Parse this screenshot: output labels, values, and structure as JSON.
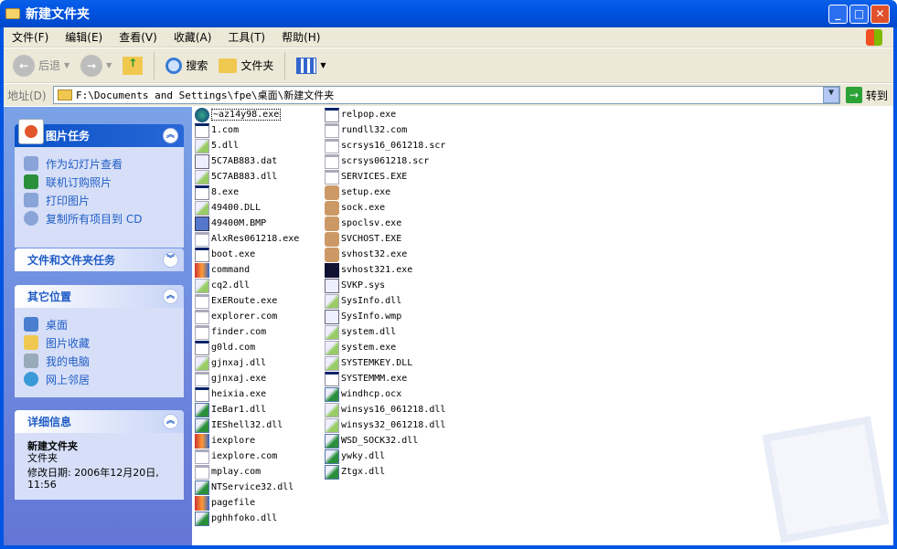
{
  "window": {
    "title": "新建文件夹",
    "min": "_",
    "max": "□",
    "close": "✕"
  },
  "menu": [
    "文件(F)",
    "编辑(E)",
    "查看(V)",
    "收藏(A)",
    "工具(T)",
    "帮助(H)"
  ],
  "toolbar": {
    "back": "后退",
    "search": "搜索",
    "folders": "文件夹"
  },
  "address": {
    "label": "地址(D)",
    "value": "F:\\Documents and Settings\\fpe\\桌面\\新建文件夹",
    "go": "转到"
  },
  "panels": {
    "picture_tasks": {
      "title": "图片任务",
      "links": [
        "作为幻灯片查看",
        "联机订购照片",
        "打印图片",
        "复制所有项目到 CD"
      ]
    },
    "file_tasks": {
      "title": "文件和文件夹任务"
    },
    "other_places": {
      "title": "其它位置",
      "links": [
        "桌面",
        "图片收藏",
        "我的电脑",
        "网上邻居"
      ]
    },
    "details": {
      "title": "详细信息",
      "name": "新建文件夹",
      "type": "文件夹",
      "modified": "修改日期: 2006年12月20日, 11:56"
    }
  },
  "files": [
    [
      {
        "n": "~az14y98.exe",
        "t": "globe"
      },
      {
        "n": "1.com",
        "t": "app"
      },
      {
        "n": "5.dll",
        "t": "dll"
      },
      {
        "n": "5C7AB883.dat",
        "t": "sys"
      },
      {
        "n": "5C7AB883.dll",
        "t": "dll"
      },
      {
        "n": "8.exe",
        "t": "app"
      },
      {
        "n": "49400.DLL",
        "t": "dll"
      },
      {
        "n": "49400M.BMP",
        "t": "bmp"
      },
      {
        "n": "AlxRes061218.exe",
        "t": "applight"
      },
      {
        "n": "boot.exe",
        "t": "app"
      },
      {
        "n": "command",
        "t": "dos"
      },
      {
        "n": "cq2.dll",
        "t": "dll"
      },
      {
        "n": "ExERoute.exe",
        "t": "applight"
      },
      {
        "n": "explorer.com",
        "t": "applight"
      },
      {
        "n": "finder.com",
        "t": "applight"
      },
      {
        "n": "g0ld.com",
        "t": "app"
      },
      {
        "n": "gjnxaj.dll",
        "t": "dll"
      },
      {
        "n": "gjnxaj.exe",
        "t": "applight"
      },
      {
        "n": "heixia.exe",
        "t": "app"
      },
      {
        "n": "IeBar1.dll",
        "t": "dllc"
      },
      {
        "n": "IEShell32.dll",
        "t": "dllc"
      },
      {
        "n": "iexplore",
        "t": "dos"
      },
      {
        "n": "iexplore.com",
        "t": "applight"
      },
      {
        "n": "mplay.com",
        "t": "applight"
      },
      {
        "n": "NTService32.dll",
        "t": "dllc"
      },
      {
        "n": "pagefile",
        "t": "dos"
      },
      {
        "n": "pghhfoko.dll",
        "t": "dllc"
      }
    ],
    [
      {
        "n": "relpop.exe",
        "t": "app"
      },
      {
        "n": "rundll32.com",
        "t": "applight"
      },
      {
        "n": "scrsys16_061218.scr",
        "t": "applight"
      },
      {
        "n": "scrsys061218.scr",
        "t": "applight"
      },
      {
        "n": "SERVICES.EXE",
        "t": "applight"
      },
      {
        "n": "setup.exe",
        "t": "pic"
      },
      {
        "n": "sock.exe",
        "t": "pic"
      },
      {
        "n": "spoclsv.exe",
        "t": "pic"
      },
      {
        "n": "SVCHOST.EXE",
        "t": "pic"
      },
      {
        "n": "svhost32.exe",
        "t": "pic"
      },
      {
        "n": "svhost321.exe",
        "t": "dark"
      },
      {
        "n": "SVKP.sys",
        "t": "sys"
      },
      {
        "n": "SysInfo.dll",
        "t": "dll"
      },
      {
        "n": "SysInfo.wmp",
        "t": "sys"
      },
      {
        "n": "system.dll",
        "t": "dll"
      },
      {
        "n": "system.exe",
        "t": "dll"
      },
      {
        "n": "SYSTEMKEY.DLL",
        "t": "dll"
      },
      {
        "n": "SYSTEMMM.exe",
        "t": "app"
      },
      {
        "n": "windhcp.ocx",
        "t": "dllc"
      },
      {
        "n": "winsys16_061218.dll",
        "t": "dll"
      },
      {
        "n": "winsys32_061218.dll",
        "t": "dll"
      },
      {
        "n": "WSD_SOCK32.dll",
        "t": "dllc"
      },
      {
        "n": "ywky.dll",
        "t": "dllc"
      },
      {
        "n": "Ztgx.dll",
        "t": "dllc"
      }
    ]
  ]
}
